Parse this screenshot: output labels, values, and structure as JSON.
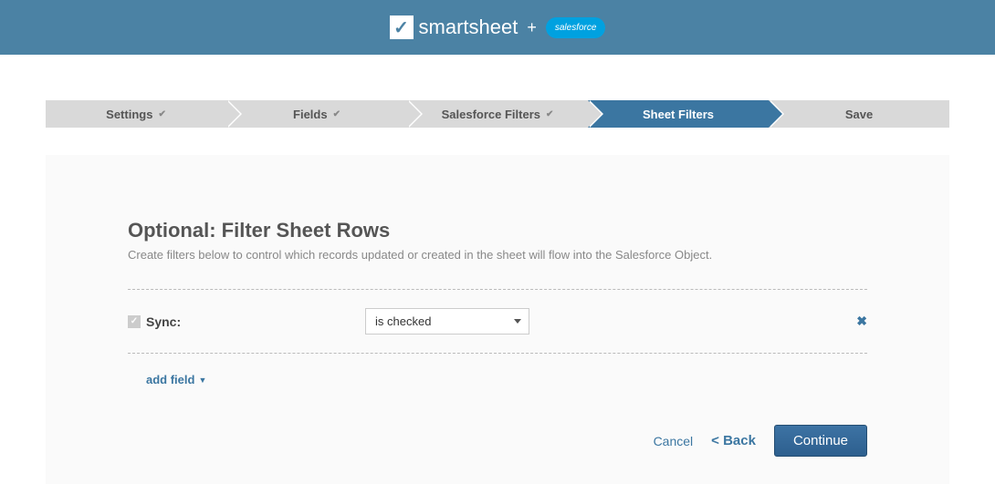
{
  "header": {
    "brand": "smartsheet",
    "plus": "+",
    "partner": "salesforce"
  },
  "wizard": {
    "steps": [
      {
        "label": "Settings",
        "completed": true,
        "active": false
      },
      {
        "label": "Fields",
        "completed": true,
        "active": false
      },
      {
        "label": "Salesforce Filters",
        "completed": true,
        "active": false
      },
      {
        "label": "Sheet Filters",
        "completed": false,
        "active": true
      },
      {
        "label": "Save",
        "completed": false,
        "active": false
      }
    ]
  },
  "panel": {
    "title": "Optional: Filter Sheet Rows",
    "subtitle": "Create filters below to control which records updated or created in the sheet will flow into the Salesforce Object."
  },
  "filter": {
    "field_label": "Sync:",
    "operator_selected": "is checked"
  },
  "add_field": {
    "label": "add field"
  },
  "actions": {
    "cancel": "Cancel",
    "back": "< Back",
    "continue": "Continue"
  }
}
